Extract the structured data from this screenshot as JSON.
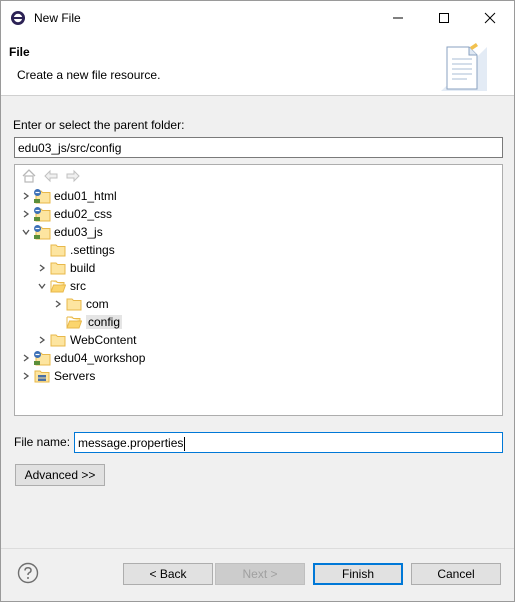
{
  "window": {
    "title": "New File"
  },
  "header": {
    "title": "File",
    "description": "Create a new file resource."
  },
  "folder": {
    "label": "Enter or select the parent folder:",
    "value": "edu03_js/src/config"
  },
  "tree": {
    "items": [
      {
        "label": "edu01_html",
        "kind": "project",
        "depth": 0,
        "expander": "collapsed"
      },
      {
        "label": "edu02_css",
        "kind": "project",
        "depth": 0,
        "expander": "collapsed"
      },
      {
        "label": "edu03_js",
        "kind": "project",
        "depth": 0,
        "expander": "expanded"
      },
      {
        "label": ".settings",
        "kind": "folder",
        "depth": 1,
        "expander": "none"
      },
      {
        "label": "build",
        "kind": "folder",
        "depth": 1,
        "expander": "collapsed"
      },
      {
        "label": "src",
        "kind": "folder-open",
        "depth": 1,
        "expander": "expanded"
      },
      {
        "label": "com",
        "kind": "folder",
        "depth": 2,
        "expander": "collapsed"
      },
      {
        "label": "config",
        "kind": "folder-open",
        "depth": 2,
        "expander": "none",
        "selected": true
      },
      {
        "label": "WebContent",
        "kind": "folder",
        "depth": 1,
        "expander": "collapsed"
      },
      {
        "label": "edu04_workshop",
        "kind": "project",
        "depth": 0,
        "expander": "collapsed"
      },
      {
        "label": "Servers",
        "kind": "servers",
        "depth": 0,
        "expander": "collapsed"
      }
    ]
  },
  "filename": {
    "label": "File name:",
    "value": "message.properties"
  },
  "advanced": {
    "label": "Advanced >>"
  },
  "buttons": {
    "back": "< Back",
    "next": "Next >",
    "finish": "Finish",
    "cancel": "Cancel"
  },
  "colors": {
    "folder": "#e8b84a",
    "accent": "#0078d7",
    "selection": "#e5e5e5"
  }
}
